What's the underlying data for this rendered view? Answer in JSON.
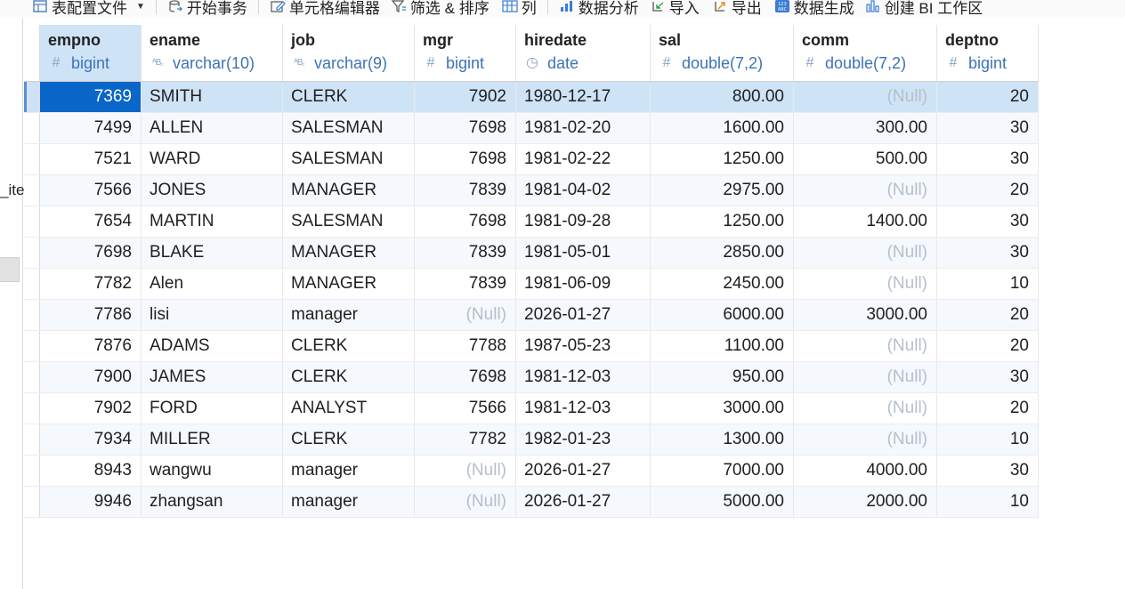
{
  "toolbar": {
    "items": [
      {
        "label": "表配置文件",
        "icon": "table-config-icon",
        "dropdown": true
      },
      {
        "label": "开始事务",
        "icon": "transaction-icon"
      },
      {
        "label": "单元格编辑器",
        "icon": "cell-editor-icon"
      },
      {
        "label": "筛选 & 排序",
        "icon": "filter-icon"
      },
      {
        "label": "列",
        "icon": "columns-icon"
      },
      {
        "label": "数据分析",
        "icon": "analysis-icon"
      },
      {
        "label": "导入",
        "icon": "import-icon"
      },
      {
        "label": "导出",
        "icon": "export-icon"
      },
      {
        "label": "数据生成",
        "icon": "data-generation-icon"
      },
      {
        "label": "创建 BI 工作区",
        "icon": "bi-workspace-icon"
      }
    ]
  },
  "left_pane": {
    "fragment_text": "_ite"
  },
  "grid": {
    "columns": [
      {
        "name": "empno",
        "type": "bigint",
        "type_icon": "number-icon",
        "align": "right"
      },
      {
        "name": "ename",
        "type": "varchar(10)",
        "type_icon": "text-icon",
        "align": "left"
      },
      {
        "name": "job",
        "type": "varchar(9)",
        "type_icon": "text-icon",
        "align": "left"
      },
      {
        "name": "mgr",
        "type": "bigint",
        "type_icon": "number-icon",
        "align": "right"
      },
      {
        "name": "hiredate",
        "type": "date",
        "type_icon": "date-icon",
        "align": "left"
      },
      {
        "name": "sal",
        "type": "double(7,2)",
        "type_icon": "number-icon",
        "align": "right"
      },
      {
        "name": "comm",
        "type": "double(7,2)",
        "type_icon": "number-icon",
        "align": "right"
      },
      {
        "name": "deptno",
        "type": "bigint",
        "type_icon": "number-icon",
        "align": "right"
      }
    ],
    "null_text": "(Null)",
    "selected_row": 0,
    "selected_column": 0,
    "rows": [
      [
        "7369",
        "SMITH",
        "CLERK",
        "7902",
        "1980-12-17",
        "800.00",
        null,
        "20"
      ],
      [
        "7499",
        "ALLEN",
        "SALESMAN",
        "7698",
        "1981-02-20",
        "1600.00",
        "300.00",
        "30"
      ],
      [
        "7521",
        "WARD",
        "SALESMAN",
        "7698",
        "1981-02-22",
        "1250.00",
        "500.00",
        "30"
      ],
      [
        "7566",
        "JONES",
        "MANAGER",
        "7839",
        "1981-04-02",
        "2975.00",
        null,
        "20"
      ],
      [
        "7654",
        "MARTIN",
        "SALESMAN",
        "7698",
        "1981-09-28",
        "1250.00",
        "1400.00",
        "30"
      ],
      [
        "7698",
        "BLAKE",
        "MANAGER",
        "7839",
        "1981-05-01",
        "2850.00",
        null,
        "30"
      ],
      [
        "7782",
        "Alen",
        "MANAGER",
        "7839",
        "1981-06-09",
        "2450.00",
        null,
        "10"
      ],
      [
        "7786",
        "lisi",
        "manager",
        null,
        "2026-01-27",
        "6000.00",
        "3000.00",
        "20"
      ],
      [
        "7876",
        "ADAMS",
        "CLERK",
        "7788",
        "1987-05-23",
        "1100.00",
        null,
        "20"
      ],
      [
        "7900",
        "JAMES",
        "CLERK",
        "7698",
        "1981-12-03",
        "950.00",
        null,
        "30"
      ],
      [
        "7902",
        "FORD",
        "ANALYST",
        "7566",
        "1981-12-03",
        "3000.00",
        null,
        "20"
      ],
      [
        "7934",
        "MILLER",
        "CLERK",
        "7782",
        "1982-01-23",
        "1300.00",
        null,
        "10"
      ],
      [
        "8943",
        "wangwu",
        "manager",
        null,
        "2026-01-27",
        "7000.00",
        "4000.00",
        "30"
      ],
      [
        "9946",
        "zhangsan",
        "manager",
        null,
        "2026-01-27",
        "5000.00",
        "2000.00",
        "10"
      ]
    ]
  },
  "colors": {
    "accent": "#0a66c8",
    "selection": "#cfe3f7",
    "null_text": "#b6bfca",
    "type_text": "#3d73b6"
  }
}
